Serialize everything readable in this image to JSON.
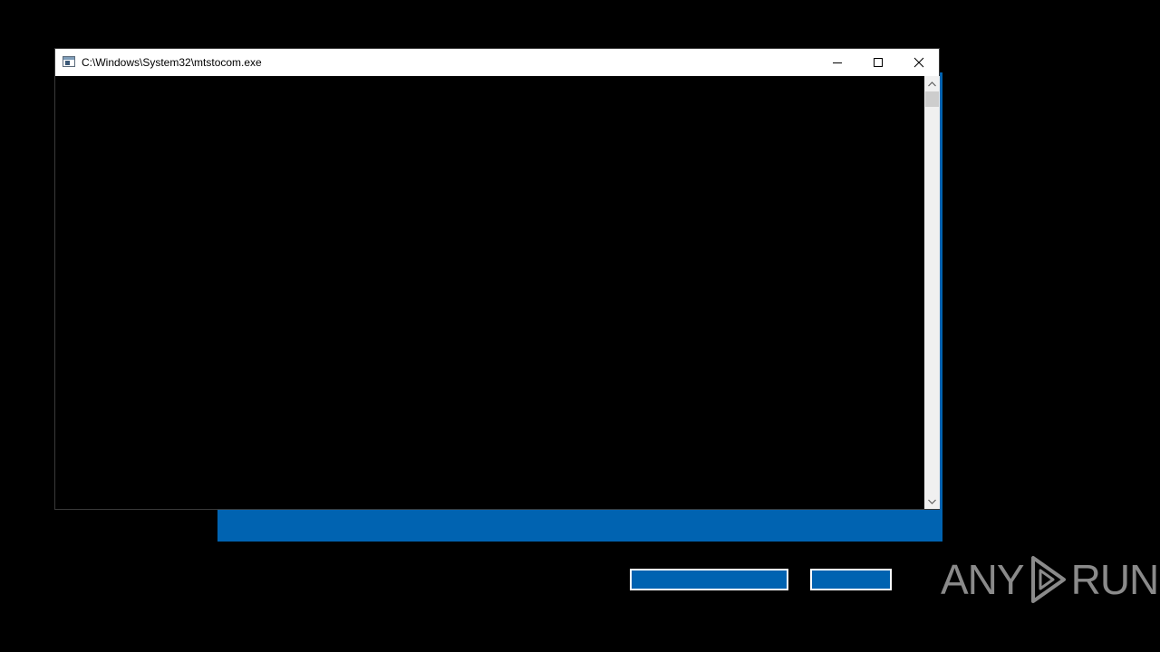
{
  "window": {
    "title": "C:\\Windows\\System32\\mtstocom.exe",
    "minimize_icon": "minimize-icon",
    "maximize_icon": "maximize-icon",
    "close_icon": "close-icon"
  },
  "console": {
    "output": ""
  },
  "background_dialog": {
    "primary_button_label": "",
    "secondary_button_label": "",
    "accent_color": "#0063b1"
  },
  "watermark": {
    "text_left": "ANY",
    "text_right": "RUN",
    "logo_icon": "play-triangle-logo"
  }
}
